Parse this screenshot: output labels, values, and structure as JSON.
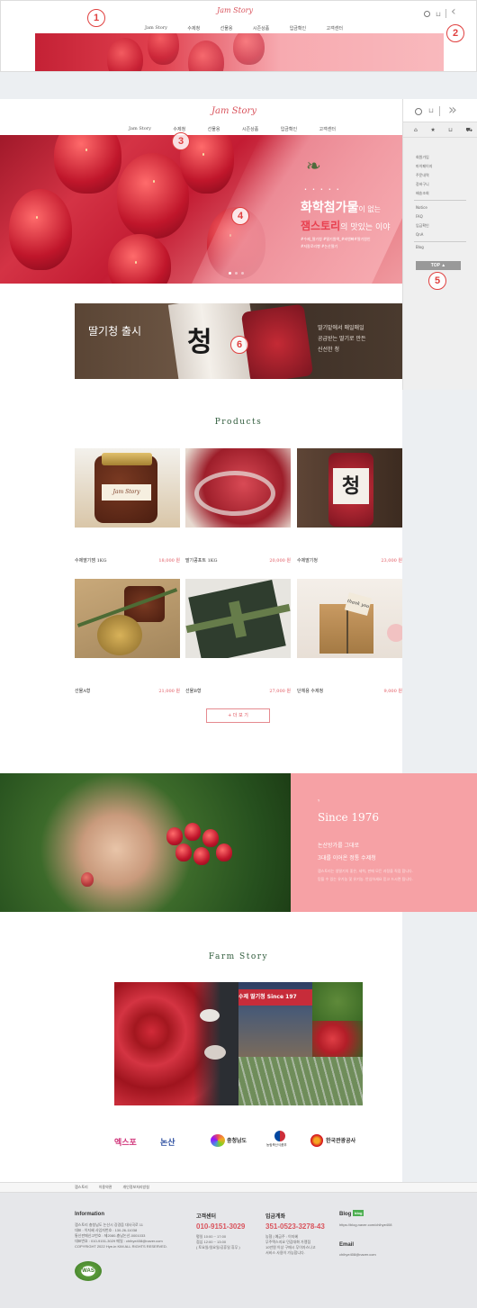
{
  "mini_header": {
    "logo": "Jam Story",
    "nav": [
      "Jam Story",
      "수제청",
      "선물용",
      "시즌상품",
      "입금확인",
      "고객센터"
    ]
  },
  "callouts": [
    "1",
    "2",
    "3",
    "4",
    "5",
    "6"
  ],
  "header": {
    "logo": "Jam Story",
    "nav": [
      "Jam Story",
      "수제청",
      "선물용",
      "시즌상품",
      "입금확인",
      "고객센터"
    ]
  },
  "hero": {
    "headline_strong": "화학첨가물",
    "headline_rest": "이 없는",
    "sub_brand": "잼스토리",
    "sub_rest": "의 맛있는 이야",
    "tags_line1": "#수제_딸기청 #딸기원액_#비엔빠#딸기원인",
    "tags_line2": "#저칼로리빵 #논산딸기"
  },
  "sidebar": {
    "links_a": [
      "회원가입",
      "마이페이지",
      "주문내역",
      "장바구니",
      "배송조회"
    ],
    "links_b": [
      "Notice",
      "FAQ",
      "입금확인",
      "QnA"
    ],
    "links_c": [
      "Blog"
    ],
    "top_button": "TOP ▲"
  },
  "banner": {
    "title": "딸기청 출시",
    "jar_char": "청",
    "desc1": "딸기밭에서 매일매일",
    "desc2": "공급받는 딸기로 만든",
    "desc3": "신선한 청"
  },
  "products": {
    "title": "Products",
    "items": [
      {
        "name": "수제딸기잼 1KG",
        "price": "18,000 원"
      },
      {
        "name": "딸기콩포트 1KG",
        "price": "20,000 원"
      },
      {
        "name": "수제딸기청",
        "price": "23,000 원"
      },
      {
        "name": "선물A형",
        "price": "21,000 원"
      },
      {
        "name": "선물B형",
        "price": "27,000 원"
      },
      {
        "name": "단체용 수제청",
        "price": "9,000 원"
      }
    ],
    "more_button": "+ 더 보 기"
  },
  "since": {
    "title": "Since 1976",
    "line1": "논산방가를 그대로",
    "line2": "3대를 이어온 정통 수제청",
    "small1": "잼스토리는 생딸기의 좋은, 세척, 판매 모든 과정을 직접 합니다.",
    "small2": "믿을 수 있는 유기농 및 유기농. 안심하세요 믿고 드시면 됩니다."
  },
  "farm": {
    "title": "Farm Story",
    "sign_text": "수제 딸기청 Since 197"
  },
  "partners": [
    "엑스포",
    "논산",
    "충청남도",
    "농림축산식품부",
    "한국관광공사"
  ],
  "footer_links": [
    "잼스토리",
    "이용약관",
    "개인정보처리방침"
  ],
  "footer": {
    "info_title": "Information",
    "info_lines": [
      "잼스토리 충청남도 논산시 강경읍 대사곡로 11",
      "대표 : 이지혜  사업자번호 : 130-26-11038",
      "통신판매신고번호 : 제2080-충남논산-0001033",
      "대표번호 : 010-9151-3029  메일 : chihye408@naver.com",
      "COPYRIGHT 2022 Hye-in KIM ALL RIGHTS RESERVED."
    ],
    "cs_title": "고객센터",
    "cs_phone": "010-9151-3029",
    "cs_lines": [
      "평일 10:00 ~ 17:00",
      "점심 12:00 ~ 13:00",
      "( 토요일/일요일/공휴일 휴무 )"
    ],
    "bank_title": "입금계좌",
    "bank_number": "351-0523-3278-43",
    "bank_lines": [
      "농협  |  예금주 : 이지혜",
      "무주택스지요 민감대화 가맹점",
      "10만원 이상 구매시 무이자스나고",
      "서비스 사용이 가능합니다."
    ],
    "blog_title": "Blog",
    "blog_badge": "blog",
    "blog_url": "https://blog.naver.com/chihye408",
    "email_title": "Email",
    "email": "chihye408@naver.com",
    "badge": "WAS"
  }
}
